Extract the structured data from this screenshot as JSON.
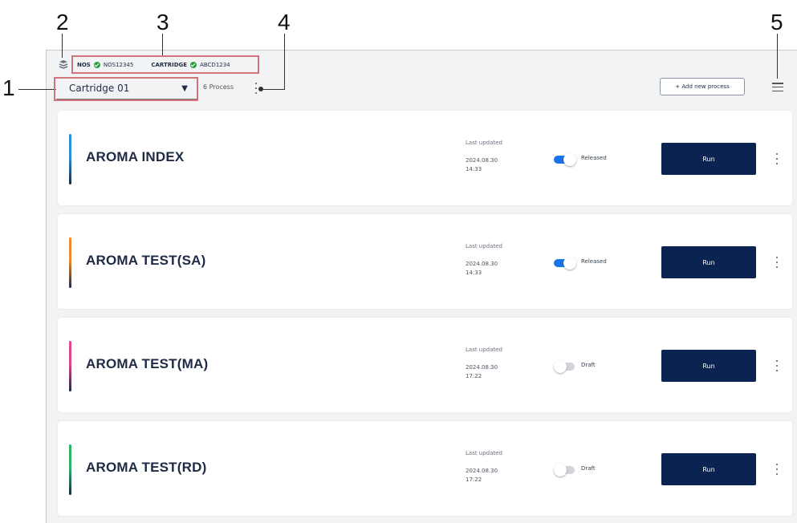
{
  "callouts": {
    "c1": "1",
    "c2": "2",
    "c3": "3",
    "c4": "4",
    "c5": "5"
  },
  "status_bar": {
    "nos_label": "NOS",
    "nos_value": "NOS12345",
    "cartridge_label": "CARTRIDGE",
    "cartridge_value": "ABCD1234"
  },
  "toolbar": {
    "cartridge_selected": "Cartridge 01",
    "caret": "▼",
    "process_count": "6 Process",
    "add_process_label": "+ Add new process"
  },
  "colors": {
    "run_button": "#0b2350",
    "toggle_on": "#1a73e8",
    "toggle_off": "#d1d5db",
    "status_ok": "#2ea043",
    "callout_box": "#d3737d"
  },
  "processes": [
    {
      "name": "AROMA INDEX",
      "updated_label": "Last updated",
      "date": "2024.08.30",
      "time": "14:33",
      "released": true,
      "status": "Released",
      "run_label": "Run",
      "accent": "#2a8fd6"
    },
    {
      "name": "AROMA TEST(SA)",
      "updated_label": "Last updated",
      "date": "2024.08.30",
      "time": "14:33",
      "released": true,
      "status": "Released",
      "run_label": "Run",
      "accent": "#ef8a2e"
    },
    {
      "name": "AROMA TEST(MA)",
      "updated_label": "Last updated",
      "date": "2024.08.30",
      "time": "17:22",
      "released": false,
      "status": "Draft",
      "run_label": "Run",
      "accent": "#e0458f"
    },
    {
      "name": "AROMA TEST(RD)",
      "updated_label": "Last updated",
      "date": "2024.08.30",
      "time": "17:22",
      "released": false,
      "status": "Draft",
      "run_label": "Run",
      "accent": "#2fb46a"
    }
  ]
}
